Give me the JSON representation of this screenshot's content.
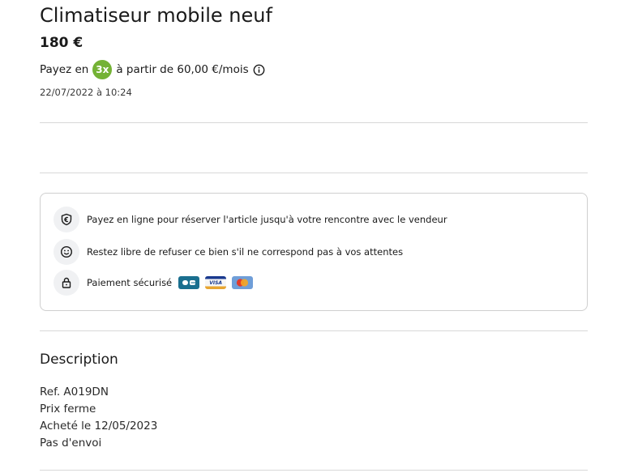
{
  "listing": {
    "title": "Climatiseur mobile neuf",
    "price": "180 €",
    "payment": {
      "prefix": "Payez en",
      "badge": "3x",
      "suffix": "à partir de 60,00 €/mois"
    },
    "date": "22/07/2022 à 10:24"
  },
  "guarantees": {
    "items": [
      {
        "icon": "euro-shield-icon",
        "text": "Payez en ligne pour réserver l'article jusqu'à votre rencontre avec le vendeur"
      },
      {
        "icon": "smiley-icon",
        "text": "Restez libre de refuser ce bien s'il ne correspond pas à vos attentes"
      },
      {
        "icon": "lock-icon",
        "text": "Paiement sécurisé"
      }
    ],
    "cards": [
      "CB",
      "VISA",
      "Mastercard"
    ]
  },
  "description": {
    "heading": "Description",
    "lines": [
      "Ref. A019DN",
      "Prix ferme",
      "Acheté le 12/05/2023",
      "Pas d'envoi"
    ]
  },
  "colors": {
    "badge_green": "#74b235",
    "divider": "#d8d8d8"
  }
}
